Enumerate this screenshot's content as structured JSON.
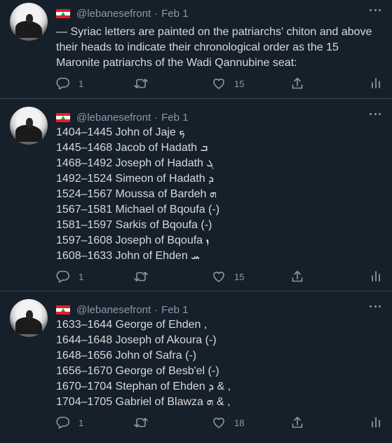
{
  "tweets": [
    {
      "handle": "@lebanesefront",
      "separator": "·",
      "date": "Feb 1",
      "lines": [
        "— Syriac letters are painted on the patriarchs' chiton and above",
        "their heads to indicate their chronological order as the 15",
        "Maronite patriarchs of the Wadi Qannubine seat:"
      ],
      "reply_count": "1",
      "retweet_count": "",
      "like_count": "15"
    },
    {
      "handle": "@lebanesefront",
      "separator": "·",
      "date": "Feb 1",
      "lines": [
        "1404–1445 John of Jaje ܟ",
        "1445–1468 Jacob of Hadath ܒ",
        "1468–1492 Joseph of Hadath ܓ",
        "1492–1524 Simeon of Hadath ܕ",
        "1524–1567 Moussa of Bardeh ܗ",
        "1567–1581 Michael of Bqoufa (-)",
        "1581–1597 Sarkis of Bqoufa (-)",
        "1597–1608 Joseph of Bqoufa ܙ",
        "1608–1633 John of Ehden ܚ"
      ],
      "reply_count": "1",
      "retweet_count": "",
      "like_count": "15"
    },
    {
      "handle": "@lebanesefront",
      "separator": "·",
      "date": "Feb 1",
      "lines": [
        "1633–1644 George of Ehden ,",
        "1644–1648 Joseph of Akoura (-)",
        "1648–1656 John of Safra (-)",
        "1656–1670 George of Besb'el (-)",
        "1670–1704 Stephan of Ehden ܕ & ,",
        "1704–1705 Gabriel of Blawza ܗ & ,"
      ],
      "reply_count": "1",
      "retweet_count": "",
      "like_count": "18"
    }
  ],
  "colors": {
    "background": "#15202b",
    "text": "#d9d9d9",
    "muted": "#8b98a5",
    "divider": "#38444d",
    "flag_red": "#ed1c24",
    "flag_green": "#00a651"
  },
  "icons": {
    "reply": "speech-bubble-icon",
    "retweet": "retweet-arrows-icon",
    "like": "heart-icon",
    "share": "share-upload-icon",
    "analytics": "bar-chart-icon",
    "more": "more-dots-icon",
    "flag": "lebanon-flag-icon"
  }
}
